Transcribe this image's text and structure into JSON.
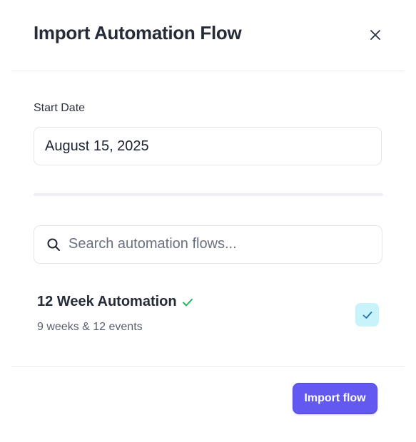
{
  "modal": {
    "title": "Import Automation Flow",
    "close_icon": "close-icon"
  },
  "start_date": {
    "label": "Start Date",
    "value": "August 15, 2025"
  },
  "search": {
    "icon": "search-icon",
    "placeholder": "Search automation flows...",
    "value": ""
  },
  "flows": [
    {
      "name": "12 Week Automation",
      "meta": "9 weeks & 12 events",
      "verified": true,
      "verified_icon": "check-icon",
      "selected": true
    }
  ],
  "footer": {
    "import_label": "Import flow"
  },
  "colors": {
    "accent": "#6359f0",
    "verified_green": "#22b55a",
    "checkbox_bg": "#c8f3fb",
    "checkbox_check": "#1f6fb5",
    "divider": "#ebedf1"
  }
}
